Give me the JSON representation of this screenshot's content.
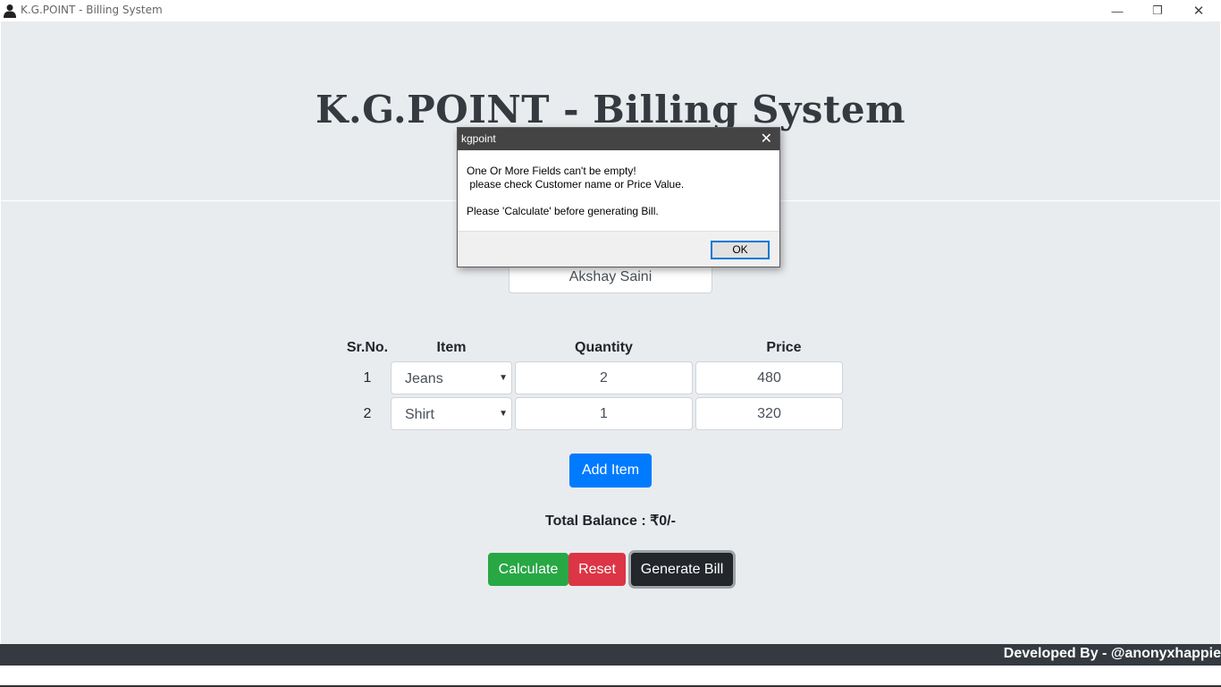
{
  "window": {
    "title": "K.G.POINT - Billing System",
    "controls": {
      "minimize": "—",
      "restore": "❐",
      "close": "✕"
    }
  },
  "header": {
    "title": "K.G.POINT - Billing System"
  },
  "customer": {
    "name": "Akshay Saini"
  },
  "table": {
    "headers": {
      "srno": "Sr.No.",
      "item": "Item",
      "quantity": "Quantity",
      "price": "Price"
    },
    "rows": [
      {
        "srno": "1",
        "item": "Jeans",
        "quantity": "2",
        "price": "480"
      },
      {
        "srno": "2",
        "item": "Shirt",
        "quantity": "1",
        "price": "320"
      }
    ]
  },
  "buttons": {
    "add_item": "Add Item",
    "calculate": "Calculate",
    "reset": "Reset",
    "generate_bill": "Generate Bill"
  },
  "total": {
    "text": "Total Balance : ₹0/-"
  },
  "footer": {
    "text": "Developed By - @anonyxhappie"
  },
  "dialog": {
    "title": "kgpoint",
    "close": "✕",
    "message": "One Or More Fields can't be empty!\n please check Customer name or Price Value.\n\nPlease 'Calculate' before generating Bill.",
    "ok": "OK"
  },
  "icons": {
    "app": "user-icon",
    "caret": "caret-down-icon"
  },
  "colors": {
    "primary": "#007bff",
    "success": "#28a745",
    "danger": "#dc3545",
    "dark": "#23272b",
    "footer": "#343a40"
  }
}
